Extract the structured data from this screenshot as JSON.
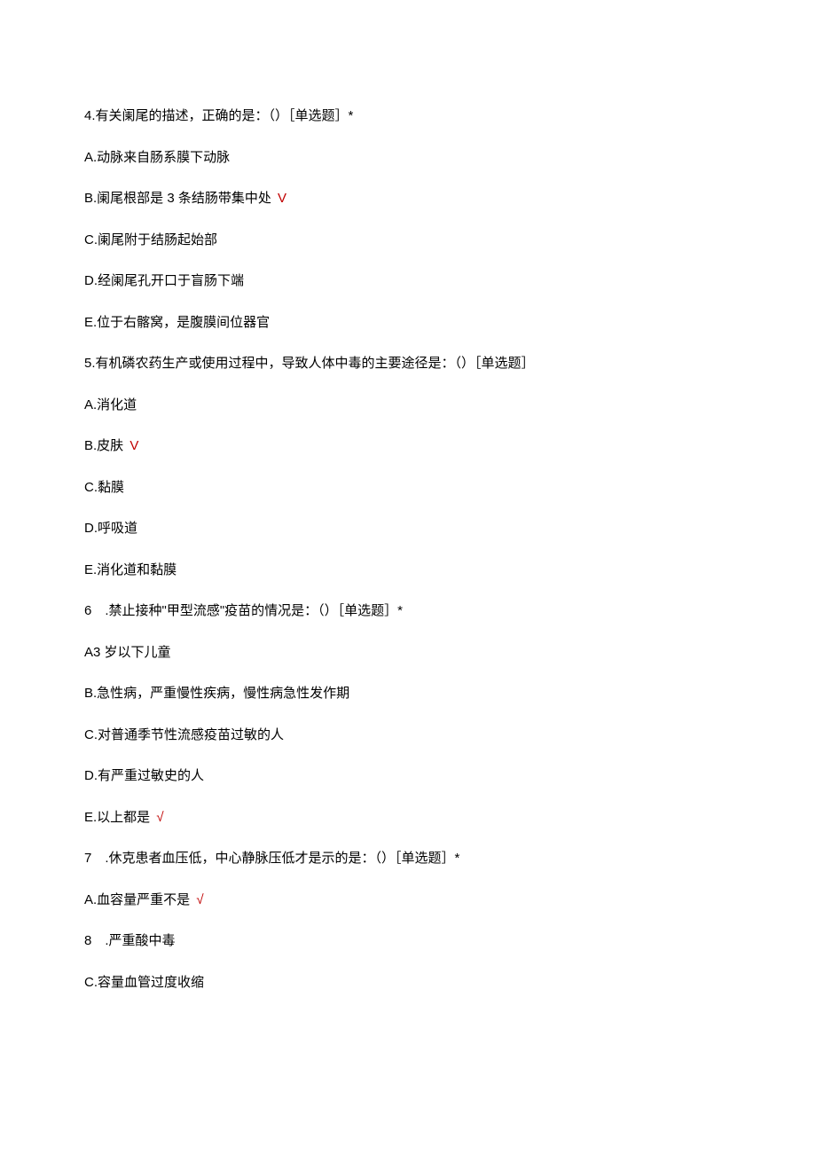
{
  "questions": [
    {
      "text": "4.有关阑尾的描述，正确的是：（）［单选题］*",
      "options": [
        {
          "label": "A.动脉来自肠系膜下动脉",
          "correct": false
        },
        {
          "label": "B.阑尾根部是 3 条结肠带集中处",
          "correct": true,
          "mark": " V"
        },
        {
          "label": "C.阑尾附于结肠起始部",
          "correct": false
        },
        {
          "label": "D.经阑尾孔开口于盲肠下端",
          "correct": false
        },
        {
          "label": "E.位于右髂窝，是腹膜间位器官",
          "correct": false
        }
      ]
    },
    {
      "text": "5.有机磷农药生产或使用过程中，导致人体中毒的主要途径是：（）［单选题］",
      "options": [
        {
          "label": "A.消化道",
          "correct": false
        },
        {
          "label": "B.皮肤",
          "correct": true,
          "mark": " V"
        },
        {
          "label": "C.黏膜",
          "correct": false
        },
        {
          "label": "D.呼吸道",
          "correct": false
        },
        {
          "label": "E.消化道和黏膜",
          "correct": false
        }
      ]
    },
    {
      "text": "6　.禁止接种\"甲型流感\"疫苗的情况是：（）［单选题］*",
      "options": [
        {
          "label": "A3 岁以下儿童",
          "correct": false
        },
        {
          "label": "B.急性病，严重慢性疾病，慢性病急性发作期",
          "correct": false
        },
        {
          "label": "C.对普通季节性流感疫苗过敏的人",
          "correct": false
        },
        {
          "label": "D.有严重过敏史的人",
          "correct": false
        },
        {
          "label": "E.以上都是",
          "correct": true,
          "mark": " √"
        }
      ]
    },
    {
      "text": "7　.休克患者血压低，中心静脉压低才是示的是：（）［单选题］*",
      "options": [
        {
          "label": "A.血容量严重不是",
          "correct": true,
          "mark": " √"
        },
        {
          "label": "8　.严重酸中毒",
          "correct": false
        },
        {
          "label": "C.容量血管过度收缩",
          "correct": false
        }
      ]
    }
  ]
}
